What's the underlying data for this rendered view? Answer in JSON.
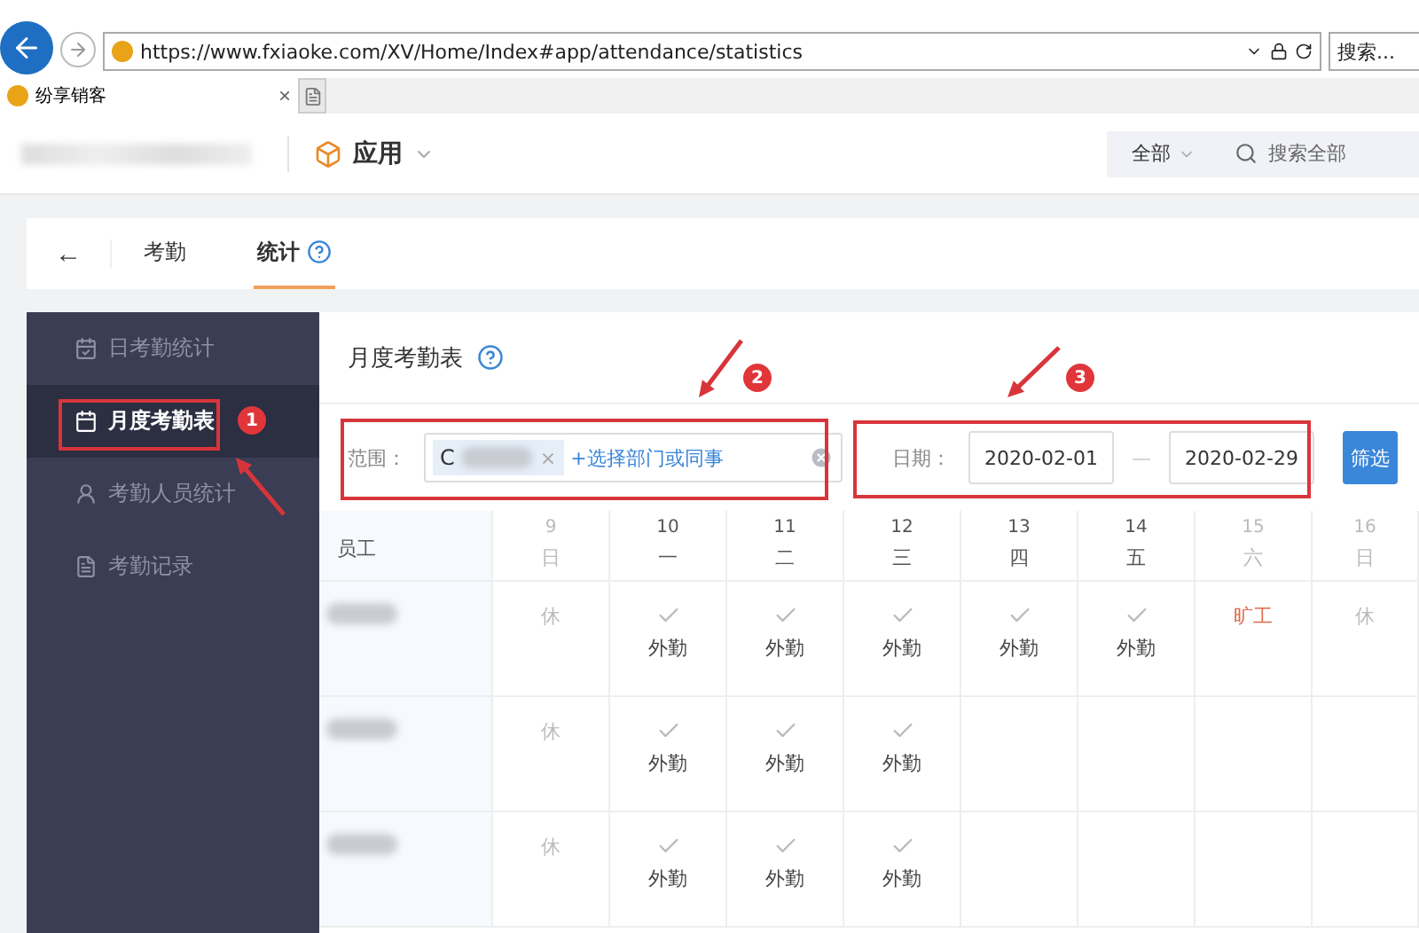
{
  "browser": {
    "url": "https://www.fxiaoke.com/XV/Home/Index#app/attendance/statistics",
    "search_placeholder": "搜索...",
    "tab": {
      "title": "纷享销客",
      "close": "×"
    }
  },
  "header": {
    "app_menu": "应用",
    "scope": "全部",
    "search_placeholder": "搜索全部"
  },
  "subnav": {
    "back": "←",
    "tabs": [
      {
        "label": "考勤",
        "selected": false,
        "help": false
      },
      {
        "label": "统计",
        "selected": true,
        "help": true
      }
    ]
  },
  "sidebar": [
    {
      "label": "日考勤统计",
      "selected": false
    },
    {
      "label": "月度考勤表",
      "selected": true
    },
    {
      "label": "考勤人员统计",
      "selected": false
    },
    {
      "label": "考勤记录",
      "selected": false
    }
  ],
  "main": {
    "title": "月度考勤表",
    "filter": {
      "scope_label": "范围：",
      "tag": "C",
      "tag_remove": "×",
      "add_link": "+选择部门或同事",
      "date_label": "日期：",
      "start": "2020-02-01",
      "separator": "—",
      "end": "2020-02-29",
      "button": "筛选"
    },
    "table": {
      "employee_header": "员工",
      "days": [
        {
          "day": "9",
          "weekday": "日",
          "weekend": true
        },
        {
          "day": "10",
          "weekday": "一",
          "weekend": false
        },
        {
          "day": "11",
          "weekday": "二",
          "weekend": false
        },
        {
          "day": "12",
          "weekday": "三",
          "weekend": false
        },
        {
          "day": "13",
          "weekday": "四",
          "weekend": false
        },
        {
          "day": "14",
          "weekday": "五",
          "weekend": false
        },
        {
          "day": "15",
          "weekday": "六",
          "weekend": true
        },
        {
          "day": "16",
          "weekday": "日",
          "weekend": true
        }
      ],
      "rows": [
        {
          "cells": [
            {
              "kind": "rest",
              "text": "休"
            },
            {
              "kind": "field",
              "text": "外勤"
            },
            {
              "kind": "field",
              "text": "外勤"
            },
            {
              "kind": "field",
              "text": "外勤"
            },
            {
              "kind": "field",
              "text": "外勤"
            },
            {
              "kind": "field",
              "text": "外勤"
            },
            {
              "kind": "absent",
              "text": "旷工"
            },
            {
              "kind": "rest",
              "text": "休"
            }
          ]
        },
        {
          "cells": [
            {
              "kind": "rest",
              "text": "休"
            },
            {
              "kind": "field",
              "text": "外勤"
            },
            {
              "kind": "field",
              "text": "外勤"
            },
            {
              "kind": "field",
              "text": "外勤"
            },
            {
              "kind": "blank"
            },
            {
              "kind": "blank"
            },
            {
              "kind": "blank"
            },
            {
              "kind": "blank"
            }
          ]
        },
        {
          "cells": [
            {
              "kind": "rest",
              "text": "休"
            },
            {
              "kind": "field",
              "text": "外勤"
            },
            {
              "kind": "field",
              "text": "外勤"
            },
            {
              "kind": "field",
              "text": "外勤"
            },
            {
              "kind": "blank"
            },
            {
              "kind": "blank"
            },
            {
              "kind": "blank"
            },
            {
              "kind": "blank"
            }
          ]
        }
      ]
    }
  },
  "annotations": [
    {
      "number": "1"
    },
    {
      "number": "2"
    },
    {
      "number": "3"
    }
  ]
}
